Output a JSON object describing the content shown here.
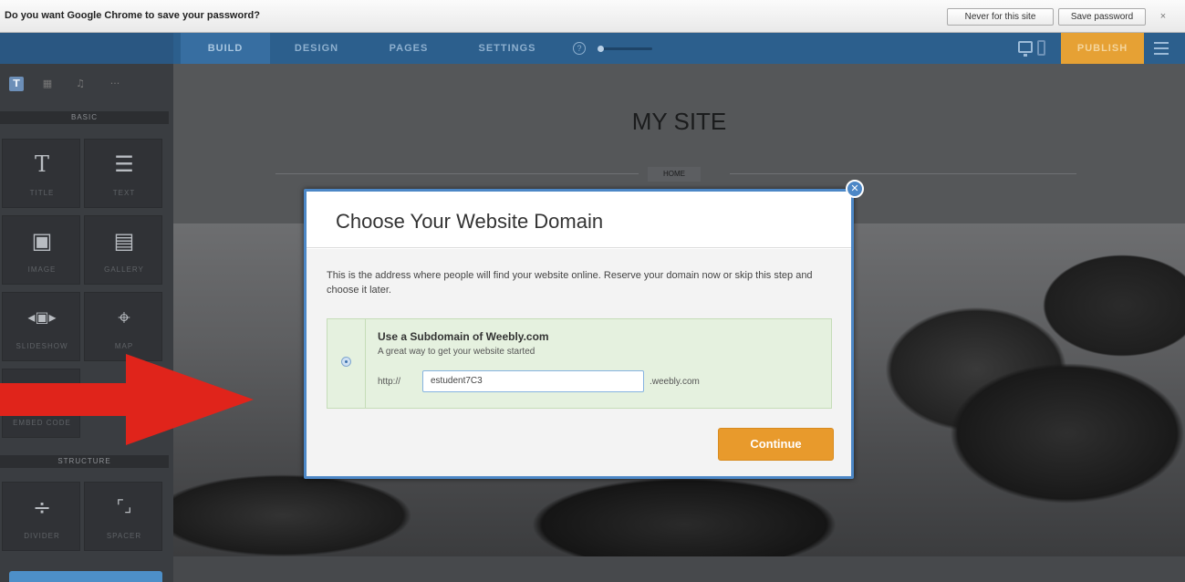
{
  "chrome_bar": {
    "question": "Do you want Google Chrome to save your password?",
    "never_label": "Never for this site",
    "save_label": "Save password",
    "close_glyph": "×"
  },
  "topnav": {
    "tabs": [
      {
        "label": "BUILD",
        "active": true
      },
      {
        "label": "DESIGN",
        "active": false
      },
      {
        "label": "PAGES",
        "active": false
      },
      {
        "label": "SETTINGS",
        "active": false
      }
    ],
    "help_glyph": "?",
    "publish_label": "PUBLISH",
    "icons": [
      "desktop-icon",
      "mobile-icon",
      "hamburger-menu-icon"
    ]
  },
  "sidebar": {
    "tab_glyphs": [
      "T",
      "▦",
      "♫",
      "···"
    ],
    "section_basic": "BASIC",
    "section_structure": "STRUCTURE",
    "tiles": [
      {
        "glyph": "T",
        "label": "TITLE",
        "name": "title"
      },
      {
        "glyph": "☰",
        "label": "TEXT",
        "name": "text"
      },
      {
        "glyph": "▣",
        "label": "IMAGE",
        "name": "image"
      },
      {
        "glyph": "▤",
        "label": "GALLERY",
        "name": "gallery"
      },
      {
        "glyph": "◂▣▸",
        "label": "SLIDESHOW",
        "name": "slideshow"
      },
      {
        "glyph": "⌖",
        "label": "MAP",
        "name": "map"
      },
      {
        "glyph": "",
        "label": "EMBED CODE",
        "name": "embed-code"
      },
      {
        "glyph": "÷",
        "label": "DIVIDER",
        "name": "divider"
      },
      {
        "glyph": "⌜⌟",
        "label": "SPACER",
        "name": "spacer"
      }
    ]
  },
  "site": {
    "title": "MY SITE",
    "nav_home": "HOME"
  },
  "modal": {
    "title": "Choose Your Website Domain",
    "description": "This is the address where people will find your website online. Reserve your domain now or skip this step and choose it later.",
    "option_title": "Use a Subdomain of Weebly.com",
    "option_subtitle": "A great way to get your website started",
    "prefix": "http://",
    "subdomain_value": "estudent7C3",
    "suffix": ".weebly.com",
    "continue_label": "Continue",
    "close_glyph": "✕"
  },
  "colors": {
    "nav_blue": "#2c5f8d",
    "publish_orange": "#e6a134",
    "continue_orange": "#e89a2c",
    "arrow_red": "#e0241b",
    "modal_border": "#4c87c6",
    "option_green": "#e5f1df"
  }
}
